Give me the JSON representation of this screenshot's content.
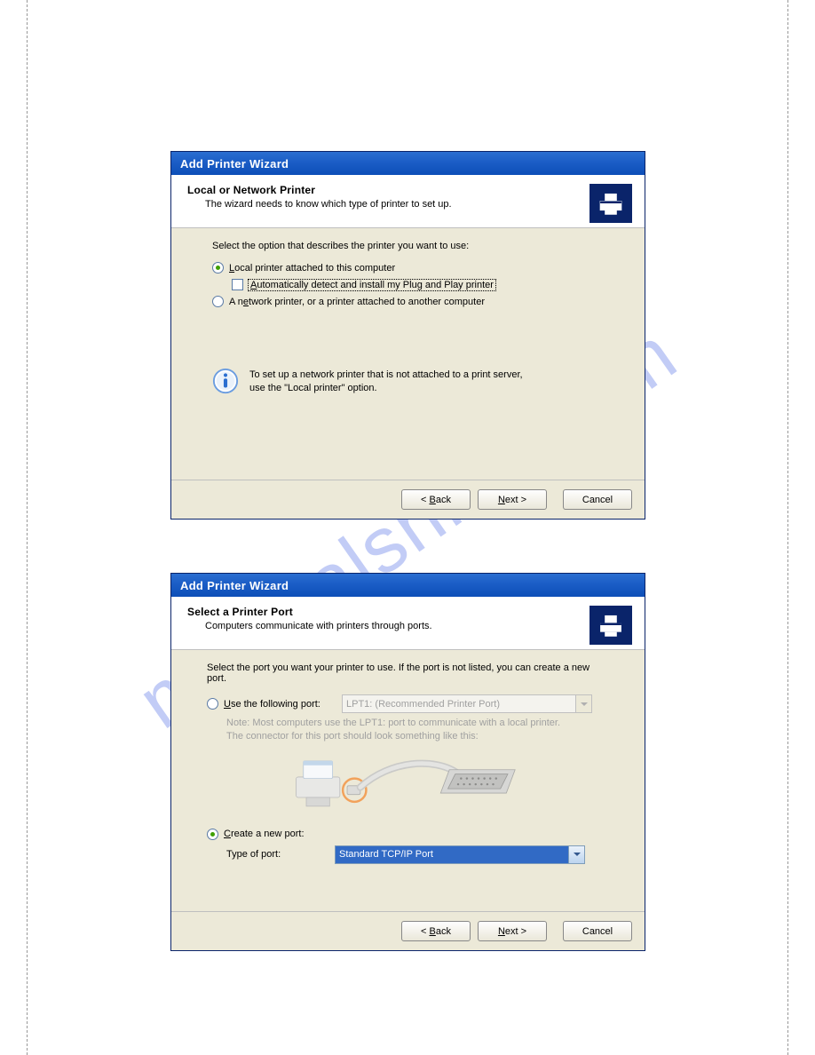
{
  "watermark": "manualshive.com",
  "dialog1": {
    "title": "Add Printer Wizard",
    "header_title": "Local or Network Printer",
    "header_sub": "The wizard needs to know which type of printer to set up.",
    "instruction": "Select the option that describes the printer you want to use:",
    "radio_local_pre": "L",
    "radio_local_post": "ocal printer attached to this computer",
    "check_auto_pre": "A",
    "check_auto_post": "utomatically detect and install my Plug and Play printer",
    "radio_net_pre": "A n",
    "radio_net_u": "e",
    "radio_net_post": "twork printer, or a printer attached to another computer",
    "info_line1": "To set up a network printer that is not attached to a print server,",
    "info_line2": "use the \"Local printer\" option.",
    "back_pre": "< ",
    "back_u": "B",
    "back_post": "ack",
    "next_u": "N",
    "next_post": "ext >",
    "cancel": "Cancel"
  },
  "dialog2": {
    "title": "Add Printer Wizard",
    "header_title": "Select a Printer Port",
    "header_sub": "Computers communicate with printers through ports.",
    "instruction": "Select the port you want your printer to use.  If the port is not listed, you can create a new port.",
    "radio_use_u": "U",
    "radio_use_post": "se the following port:",
    "port_disabled": "LPT1: (Recommended Printer Port)",
    "note_line1": "Note: Most computers use the LPT1: port to communicate with a local printer.",
    "note_line2": "The connector for this port should look something like this:",
    "radio_create_u": "C",
    "radio_create_post": "reate a new port:",
    "type_label": "Type of port:",
    "type_value": "Standard TCP/IP Port",
    "back_pre": "< ",
    "back_u": "B",
    "back_post": "ack",
    "next_u": "N",
    "next_post": "ext >",
    "cancel": "Cancel"
  }
}
